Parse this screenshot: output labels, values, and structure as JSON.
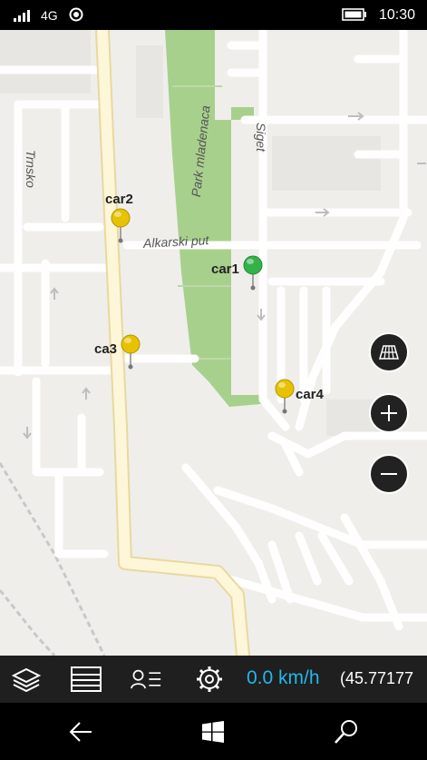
{
  "status_bar": {
    "network": "4G",
    "time": "10:30",
    "icons": [
      "signal-icon",
      "location-icon",
      "battery-icon"
    ]
  },
  "map": {
    "labels": {
      "trnsko": "Trnsko",
      "park": "Park mladenaca",
      "siget": "Siget",
      "alkarski": "Alkarski put"
    },
    "cars": [
      {
        "label": "car2",
        "color": "#e8c200"
      },
      {
        "label": "car1",
        "color": "#33b24a"
      },
      {
        "label": "ca3",
        "color": "#e8c200"
      },
      {
        "label": "car4",
        "color": "#e8c200"
      }
    ],
    "controls": [
      "map-mode-icon",
      "zoom-in-icon",
      "zoom-out-icon"
    ]
  },
  "app_bar": {
    "speed": "0.0 km/h",
    "coords": "(45.77177",
    "buttons": [
      "layers-icon",
      "list-icon",
      "user-list-icon",
      "settings-icon"
    ]
  },
  "nav_bar": {
    "buttons": [
      "back-icon",
      "windows-icon",
      "search-icon"
    ]
  },
  "colors": {
    "accent": "#22b8ea",
    "park": "#a8d08d",
    "main_road": "#fdf6d8",
    "app_bar": "#1f1f1f"
  }
}
